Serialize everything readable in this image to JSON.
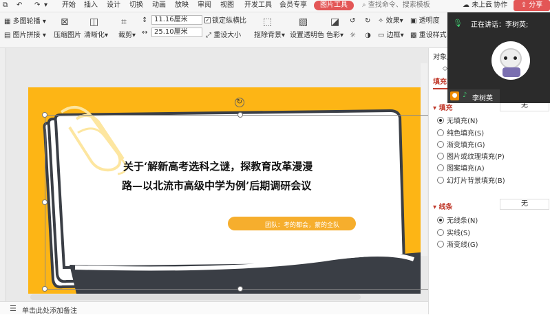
{
  "menu": {
    "items": [
      "开始",
      "插入",
      "设计",
      "切换",
      "动画",
      "放映",
      "审阅",
      "视图",
      "开发工具",
      "会员专享"
    ],
    "active_tab": "图片工具",
    "search": "查找命令、搜索模板",
    "cloud": "未上云",
    "collab": "协作",
    "share": "分享"
  },
  "ribbon": {
    "multi_carousel": "多图轮播",
    "pic_collage": "图片拼接",
    "compress": "压缩图片",
    "sharpen": "清晰化",
    "crop": "裁剪",
    "height": "11.16厘米",
    "width": "25.10厘米",
    "lock_ratio": "锁定纵横比",
    "resize": "重设大小",
    "remove_bg": "抠除背景",
    "set_transparent": "设置透明色",
    "color": "色彩",
    "effect": "效果",
    "border": "边框",
    "transparency": "透明度",
    "reset_style": "重设样式"
  },
  "slide": {
    "title_line1": "关于‘解新高考选科之谜，探教育改革漫漫",
    "title_line2": "路—以北流市高级中学为例’后期调研会议",
    "team": "团队：考的都会，蒙的全队"
  },
  "notes": {
    "placeholder": "单击此处添加备注"
  },
  "panel": {
    "header": "对象属",
    "tab_fill": "填充",
    "fill_section": "填充",
    "fill_value": "无",
    "fill_options": [
      {
        "label": "无填充(N)",
        "selected": true
      },
      {
        "label": "纯色填充(S)",
        "selected": false
      },
      {
        "label": "渐变填充(G)",
        "selected": false
      },
      {
        "label": "图片或纹理填充(P)",
        "selected": false
      },
      {
        "label": "图案填充(A)",
        "selected": false
      },
      {
        "label": "幻灯片背景填充(B)",
        "selected": false
      }
    ],
    "line_section": "线条",
    "line_value": "无",
    "line_options": [
      {
        "label": "无线条(N)",
        "selected": true
      },
      {
        "label": "实线(S)",
        "selected": false
      },
      {
        "label": "渐变线(G)",
        "selected": false
      }
    ]
  },
  "meeting": {
    "speaking_label": "正在讲话：李树英;",
    "user_name": "李树英"
  },
  "colors": {
    "accent": "#e35656",
    "slide_bg": "#fdb515",
    "meeting_bg": "#2b2b2b"
  }
}
